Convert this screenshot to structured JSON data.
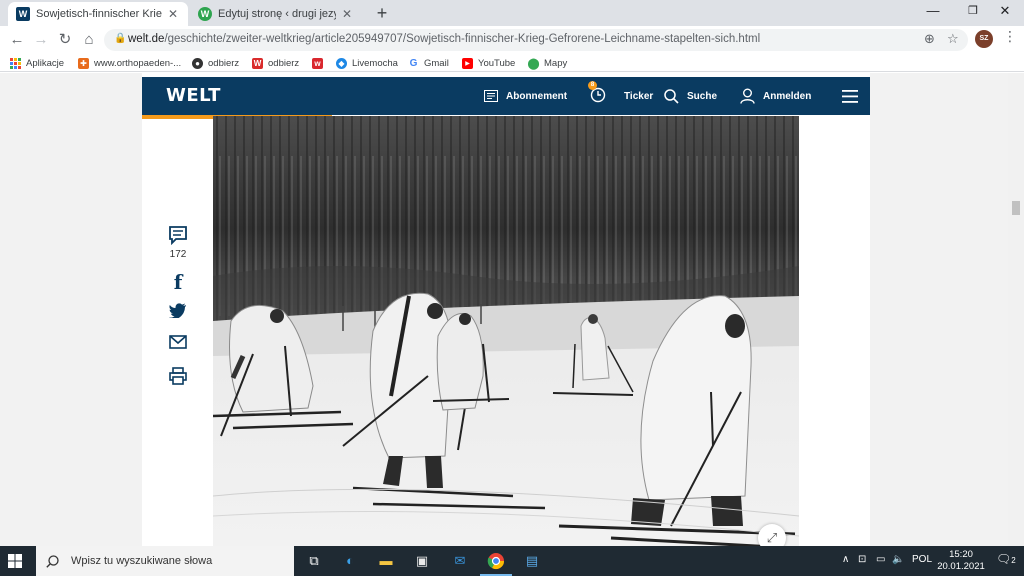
{
  "browser": {
    "tabs": [
      {
        "title": "Sowjetisch-finnischer Krieg: „Gefr",
        "favicon": "W",
        "favicon_color": "#0a3b61",
        "active": true
      },
      {
        "title": "Edytuj stronę ‹ drugi jezyk - niem",
        "favicon": "W",
        "favicon_color": "#2ea44f",
        "active": false
      }
    ],
    "url_host": "welt.de",
    "url_path": "/geschichte/zweiter-weltkrieg/article205949707/Sowjetisch-finnischer-Krieg-Gefrorene-Leichname-stapelten-sich.html",
    "profile_initials": "SZ",
    "bookmarks": [
      {
        "label": "Aplikacje",
        "icon": "apps-grid-icon",
        "color": "#e8453c"
      },
      {
        "label": "www.orthopaeden-...",
        "icon": "orthopaeden-icon",
        "color": "#e86b1c"
      },
      {
        "label": "odbierz",
        "icon": "github-icon",
        "color": "#333333"
      },
      {
        "label": "odbierz",
        "icon": "ws-icon",
        "color": "#d92b2b"
      },
      {
        "label": "Livemocha",
        "icon": "wp-icon",
        "color": "#d9272e"
      },
      {
        "label": "Gmail",
        "icon": "livemocha-icon",
        "color": "#1e88e5"
      },
      {
        "label": "YouTube",
        "icon": "google-icon",
        "color": "#4285f4"
      },
      {
        "label": "Mapy",
        "icon": "youtube-icon",
        "color": "#ff0000"
      }
    ]
  },
  "site": {
    "logo": "WELT",
    "nav": {
      "subscription": "Abonnement",
      "ticker": "Ticker",
      "ticker_badge": "8",
      "search": "Suche",
      "login": "Anmelden"
    },
    "comment_count": "172",
    "colors": {
      "brand": "#0a3b61",
      "accent": "#f59b1c"
    }
  },
  "taskbar": {
    "search_placeholder": "Wpisz tu wyszukiwane słowa",
    "language": "POL",
    "time": "15:20",
    "date": "20.01.2021",
    "notifications": "2"
  }
}
